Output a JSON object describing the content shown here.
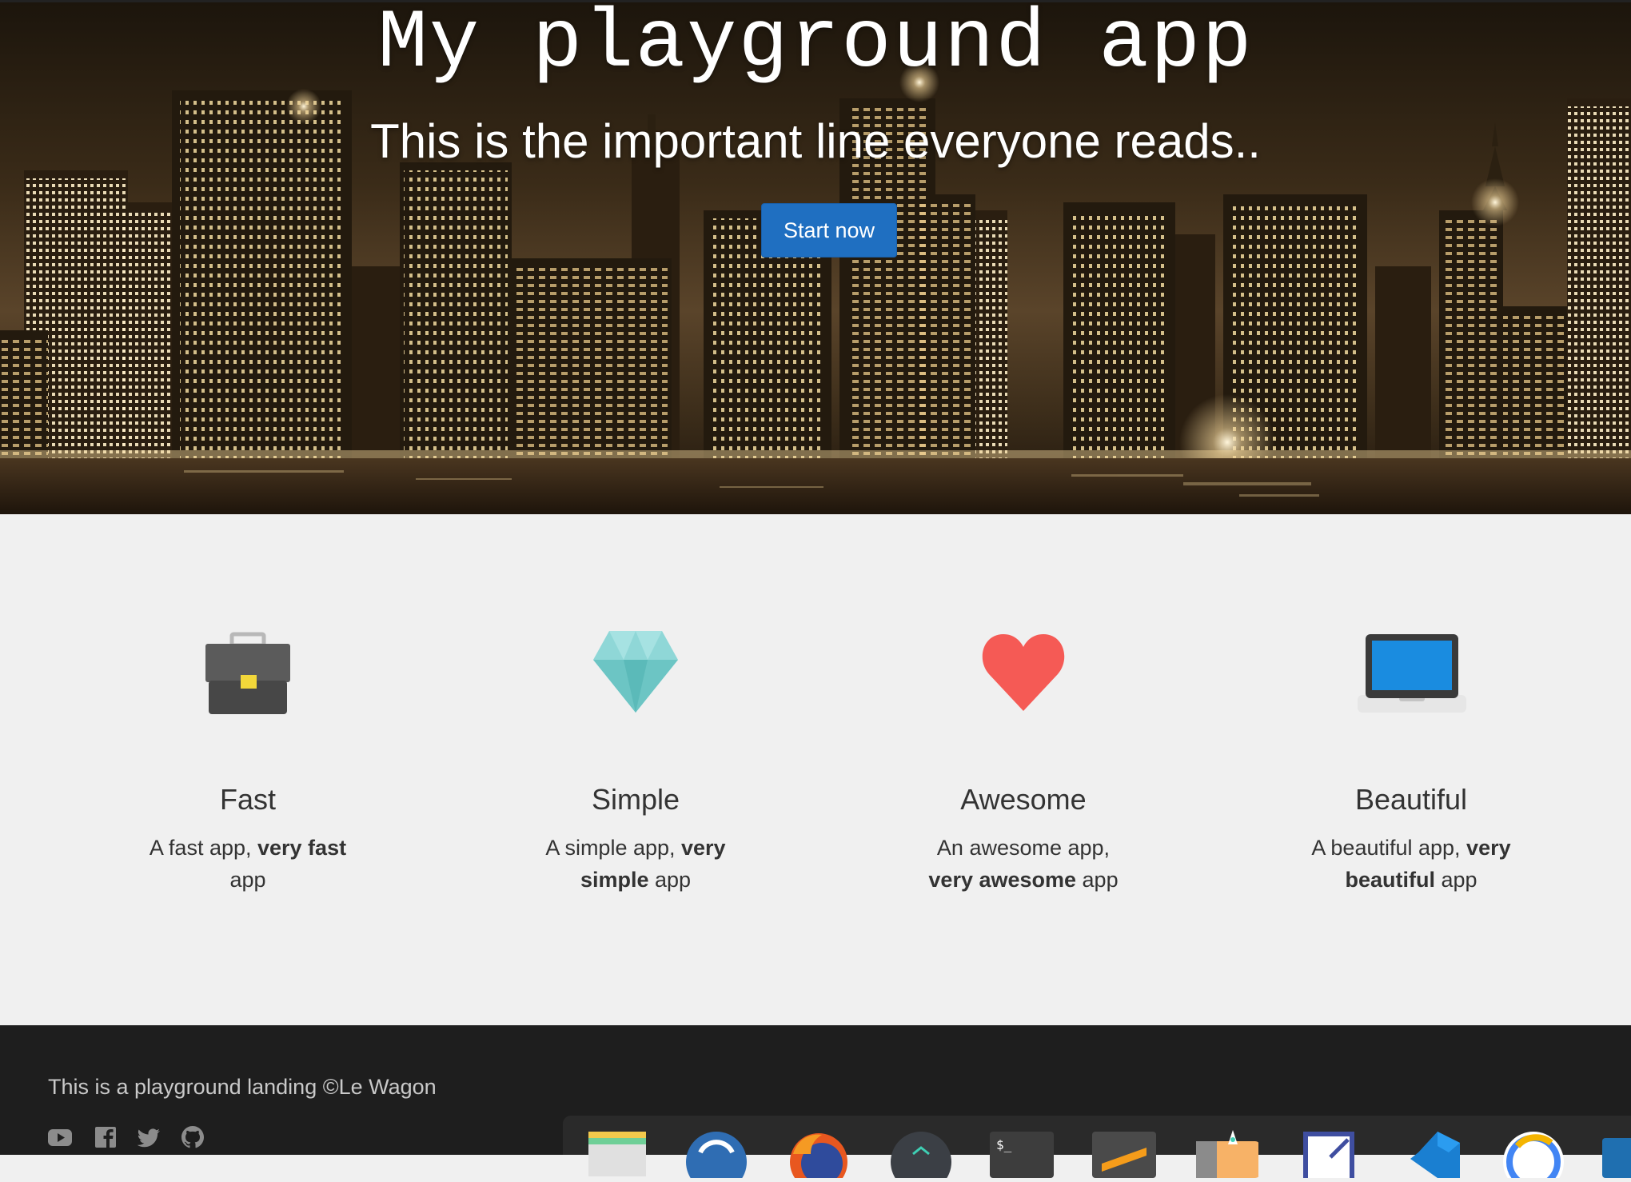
{
  "hero": {
    "title": "My playground app",
    "subtitle": "This is the important line everyone reads..",
    "cta_label": "Start now"
  },
  "features": [
    {
      "icon": "briefcase-icon",
      "title": "Fast",
      "desc_plain_1": "A fast app, ",
      "desc_bold": "very fast",
      "desc_plain_2": " app"
    },
    {
      "icon": "diamond-icon",
      "title": "Simple",
      "desc_plain_1": "A simple app, ",
      "desc_bold": "very simple",
      "desc_plain_2": " app"
    },
    {
      "icon": "heart-icon",
      "title": "Awesome",
      "desc_plain_1": "An awesome app, ",
      "desc_bold": "very awesome",
      "desc_plain_2": " app"
    },
    {
      "icon": "laptop-icon",
      "title": "Beautiful",
      "desc_plain_1": "A beautiful app, ",
      "desc_bold": "very beautiful",
      "desc_plain_2": " app"
    }
  ],
  "footer": {
    "text": "This is a playground landing ©Le Wagon",
    "social_icons": [
      "youtube-icon",
      "facebook-icon",
      "twitter-icon",
      "github-icon"
    ]
  },
  "dock": {
    "apps": [
      "files-app-icon",
      "browser-app-icon",
      "firefox-app-icon",
      "dev-tool-app-icon",
      "terminal-app-icon",
      "sublime-text-app-icon",
      "launcher-app-icon",
      "screenshot-app-icon",
      "vscode-app-icon",
      "chrome-app-icon",
      "app-icon"
    ]
  },
  "colors": {
    "cta_background": "#1f6fc1",
    "page_background": "#f0f0f0",
    "footer_background": "#1e1e1e",
    "text": "#333333"
  }
}
